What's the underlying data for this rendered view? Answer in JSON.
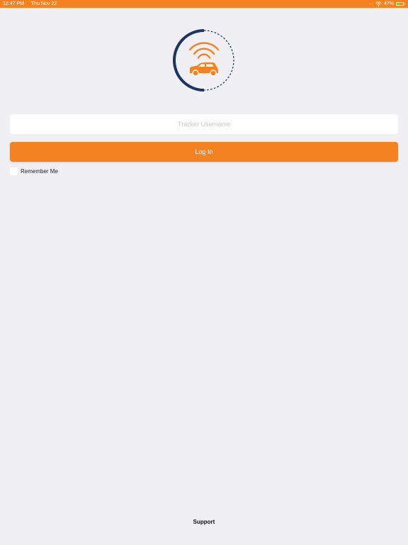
{
  "status_bar": {
    "time": "12:47 PM",
    "date": "Thu Nov 22",
    "signal_icon": "signal-dots-icon",
    "wifi_icon": "wifi-icon",
    "battery_percent": "47%",
    "battery_level": 0.47,
    "background_color": "#f58220"
  },
  "logo": {
    "icon": "car-tracker-logo-icon",
    "ring_color": "#1d3560",
    "accent_color": "#f58220"
  },
  "login_form": {
    "username_placeholder": "Tracker Username",
    "username_value": "",
    "login_label": "Log In",
    "remember_label": "Remember Me",
    "remember_checked": false,
    "accent_color": "#f58220"
  },
  "footer": {
    "support_label": "Support"
  }
}
